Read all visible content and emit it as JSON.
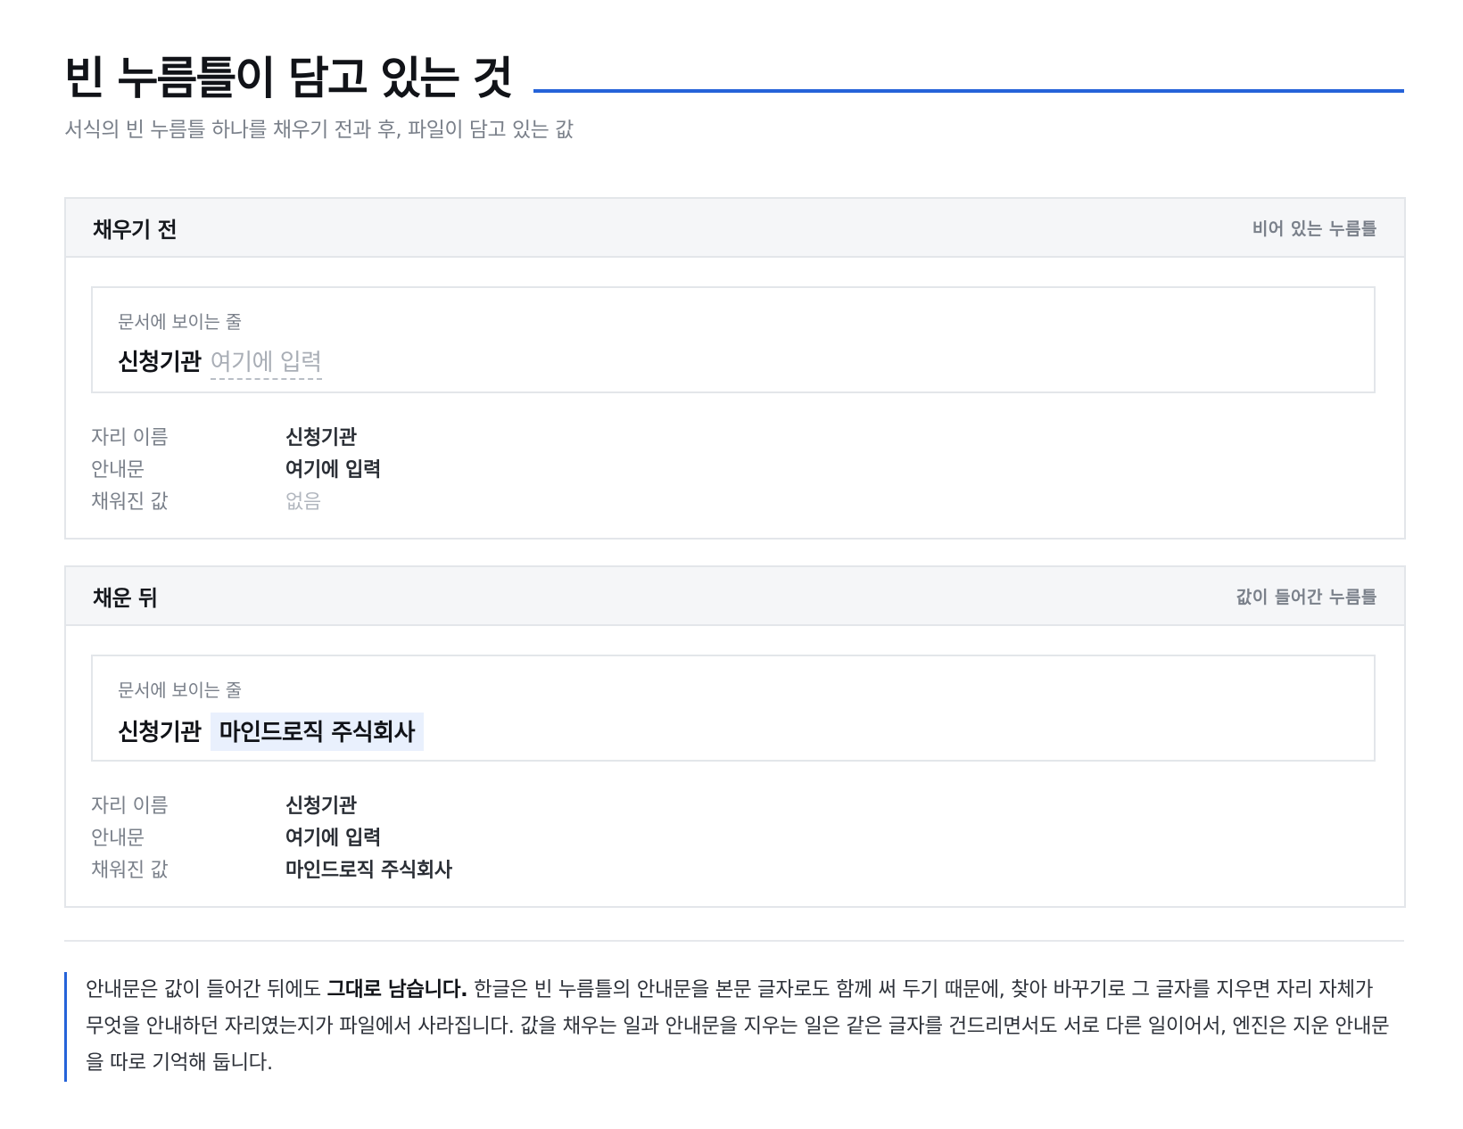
{
  "header": {
    "title": "빈 누름틀이 담고 있는 것",
    "subtitle": "서식의 빈 누름틀 하나를 채우기 전과 후, 파일이 담고 있는 값"
  },
  "before": {
    "title": "채우기 전",
    "tag": "비어 있는 누름틀",
    "line_caption": "문서에 보이는 줄",
    "line_label": "신청기관",
    "line_placeholder": "여기에 입력",
    "fields": [
      {
        "key": "자리 이름",
        "value": "신청기관"
      },
      {
        "key": "안내문",
        "value": "여기에 입력"
      },
      {
        "key": "채워진 값",
        "value": "없음"
      }
    ]
  },
  "after": {
    "title": "채운 뒤",
    "tag": "값이 들어간 누름틀",
    "line_caption": "문서에 보이는 줄",
    "line_label": "신청기관",
    "line_value": "마인드로직 주식회사",
    "fields": [
      {
        "key": "자리 이름",
        "value": "신청기관"
      },
      {
        "key": "안내문",
        "value": "여기에 입력"
      },
      {
        "key": "채워진 값",
        "value": "마인드로직 주식회사"
      }
    ]
  },
  "note": {
    "lead": "안내문은 값이 들어간 뒤에도 ",
    "emphasis": "그대로 남습니다.",
    "rest": " 한글은 빈 누름틀의 안내문을 본문 글자로도 함께 써 두기 때문에, 찾아 바꾸기로 그 글자를 지우면 자리 자체가 무엇을 안내하던 자리였는지가 파일에서 사라집니다. 값을 채우는 일과 안내문을 지우는 일은 같은 글자를 건드리면서도 서로 다른 일이어서, 엔진은 지운 안내문을 따로 기억해 둡니다."
  },
  "colors": {
    "accent": "#2563d9",
    "value_highlight": "#e9f0fd",
    "panel_header_bg": "#f5f6f8",
    "border": "#e3e6ea",
    "muted_text": "#7a808a"
  }
}
